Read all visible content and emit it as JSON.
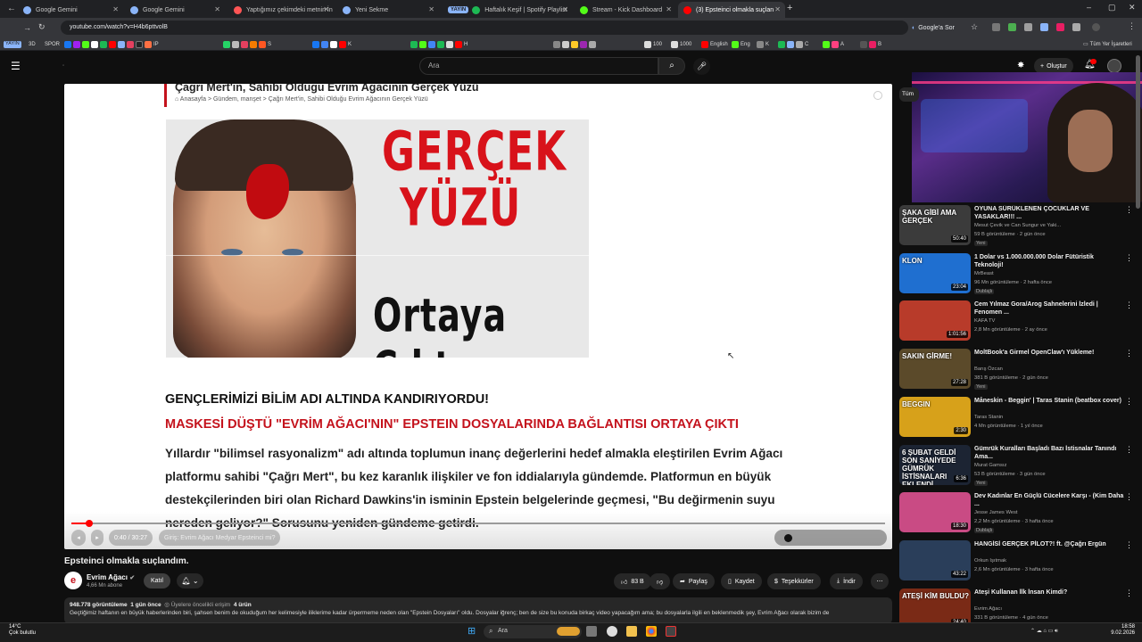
{
  "browser": {
    "tabs": [
      {
        "title": "Google Gemini",
        "color": "#8ab4f8"
      },
      {
        "title": "Google Gemini",
        "color": "#8ab4f8"
      },
      {
        "title": "Yaptığımız çekimdeki metnin İn",
        "color": "#ff5555"
      },
      {
        "title": "Yeni Sekme",
        "color": "#8ab4f8"
      },
      {
        "title": "Haftalık Keşif | Spotify Playlist",
        "color": "#1db954",
        "badge": "YAYIN"
      },
      {
        "title": "Stream - Kick Dashboard",
        "color": "#53fc18"
      },
      {
        "title": "(3) Epsteinci olmakla suçlan",
        "color": "#ff0000"
      }
    ],
    "url": "youtube.com/watch?v=H4b6pttvolB",
    "google_button": "Google'a Sor",
    "bookmarks": {
      "yayin": "YAYIN",
      "threed": "3D",
      "spor": "SPOR",
      "s": "S",
      "ip": "IP",
      "k": "K",
      "h": "H",
      "hundred": "100",
      "thousand": "1000",
      "english": "English",
      "eng": "Eng",
      "k2": "K",
      "c": "C",
      "a": "A",
      "b": "B",
      "all_bookmarks": "Tüm Yer İşaretleri"
    }
  },
  "youtube": {
    "search_placeholder": "Ara",
    "create_label": "Oluştur",
    "filter_chip": "Tüm",
    "video": {
      "article_title": "Çağrı Mert'in, Sahibi Olduğu Evrim Ağacının Gerçek Yüzü",
      "breadcrumbs": [
        "Anasayfa",
        "Gündem, manşet",
        "Çağrı Mert'in, Sahibi Olduğu Evrim Ağacının Gerçek Yüzü"
      ],
      "thumb_line1": "GERÇEK",
      "thumb_line2": "YÜZÜ",
      "thumb_line3": "Ortaya Çıktı",
      "headline1": "GENÇLERİMİZİ BİLİM ADI ALTINDA KANDIRIYORDU!",
      "headline2": "MASKESİ DÜŞTÜ \"EVRİM AĞACI'NIN\" EPSTEIN DOSYALARINDA BAĞLANTISI ORTAYA ÇIKTI",
      "body": "Yıllardır \"bilimsel rasyonalizm\" adı altında toplumun inanç değerlerini hedef almakla eleştirilen Evrim Ağacı platformu sahibi \"Çağrı Mert\", bu kez karanlık ilişkiler ve fon iddialarıyla gündemde. Platformun en büyük destekçilerinden biri olan Richard Dawkins'in isminin Epstein belgelerinde geçmesi, \"Bu değirmenin suyu nereden geliyor?\" Sorusunu yeniden gündeme getirdi.",
      "time": "0:40 / 30:27",
      "chapter": "Giriş: Evrim Ağacı Medyar Epsteinci mi?",
      "progress_fraction": 0.022
    },
    "title": "Epsteinci olmakla suçlandım.",
    "channel": {
      "name": "Evrim Ağacı",
      "subs": "4,66 Mn abone",
      "avatar": "e"
    },
    "join_label": "Katıl",
    "actions": {
      "likes": "83 B",
      "share": "Paylaş",
      "save": "Kaydet",
      "thanks": "Teşekkürler",
      "download": "İndir"
    },
    "description": {
      "views": "948.778 görüntüleme",
      "date": "1 gün önce",
      "recommend": "Üyelere öncelikli erişim",
      "products": "4 ürün",
      "text": "Geçtiğimiz haftanın en büyük haberlerinden biri, şahsen benim de okuduğum her kelimesiyle iliklerime kadar ürpermeme neden olan \"Epstein Dosyaları\" oldu. Dosyalar iğrenç; ben de size bu konuda birkaç video yapacağım ama; bu dosyalarla ilgili en beklenmedik şey, Evrim Ağacı olarak bizim de"
    },
    "sidebar": [
      {
        "title": "OYUNA SÜRÜKLENEN ÇOCUKLAR VE YASAKLAR!!! ...",
        "channel": "Mesut Çevik ve Can Sungur ve Yaki...",
        "meta": "59 B görüntüleme · 2 gün önce",
        "badge": "Yeni",
        "dur": "50:40",
        "thumb_text": "ŞAKA GİBİ AMA GERÇEK",
        "bg": "#3b3b3b"
      },
      {
        "title": "1 Dolar vs 1.000.000.000 Dolar Fütüristik Teknoloji!",
        "channel": "MrBeast",
        "meta": "96 Mn görüntüleme · 2 hafta önce",
        "badge": "Dublajlı",
        "dur": "23:04",
        "thumb_text": "KLON",
        "bg": "#1f6fd0"
      },
      {
        "title": "Cem Yılmaz Gora/Arog Sahnelerini İzledi | Fenomen ...",
        "channel": "KAFA TV",
        "meta": "2,8 Mn görüntüleme · 2 ay önce",
        "badge": "",
        "dur": "1:01:56",
        "thumb_text": "",
        "bg": "#b83b2a"
      },
      {
        "title": "MoltBook'a Girmel OpenClaw'ı Yükleme!",
        "channel": "Barış Özcan",
        "meta": "381 B görüntüleme · 2 gün önce",
        "badge": "Yeni",
        "dur": "27:28",
        "thumb_text": "SAKIN GİRME!",
        "bg": "#5b4a2a"
      },
      {
        "title": "Måneskin - Beggin' | Taras Stanin (beatbox cover)",
        "channel": "Taras Stanin",
        "meta": "4 Mn görüntüleme · 1 yıl önce",
        "badge": "",
        "dur": "2:30",
        "thumb_text": "BEGGIN",
        "bg": "#d7a11a"
      },
      {
        "title": "Gümrük Kuralları Başladı Bazı İstisnalar Tanındı Ama...",
        "channel": "Murat Gamsız",
        "meta": "53 B görüntüleme · 3 gün önce",
        "badge": "Yeni",
        "dur": "6:36",
        "thumb_text": "6 ŞUBAT GELDİ SON SANİYEDE GÜMRÜK İSTİSNALARI EKLENDİ",
        "bg": "#1c2433"
      },
      {
        "title": "Dev Kadınlar En Güçlü Cücelere Karşı - (Kim Daha ...",
        "channel": "Jesse James West",
        "meta": "2,2 Mn görüntüleme · 3 hafta önce",
        "badge": "Dublajlı",
        "dur": "18:30",
        "thumb_text": "",
        "bg": "#c94b84"
      },
      {
        "title": "HANGİSİ GERÇEK PİLOT?! ft. @Çağrı Ergün",
        "channel": "Orkun Işıtmak",
        "meta": "2,6 Mn görüntüleme · 3 hafta önce",
        "badge": "",
        "dur": "43:22",
        "thumb_text": "",
        "bg": "#2a3e5a"
      },
      {
        "title": "Ateşi Kullanan İlk İnsan Kimdi?",
        "channel": "Evrim Ağacı",
        "meta": "331 B görüntüleme · 4 gün önce",
        "badge": "Yeni",
        "dur": "24:40",
        "thumb_text": "ATEŞİ KİM BULDU?",
        "bg": "#7a2a16"
      }
    ]
  },
  "taskbar": {
    "weather_temp": "14°C",
    "weather_desc": "Çok bulutlu",
    "search": "Ara",
    "time": "18:58",
    "date": "9.02.2026"
  }
}
